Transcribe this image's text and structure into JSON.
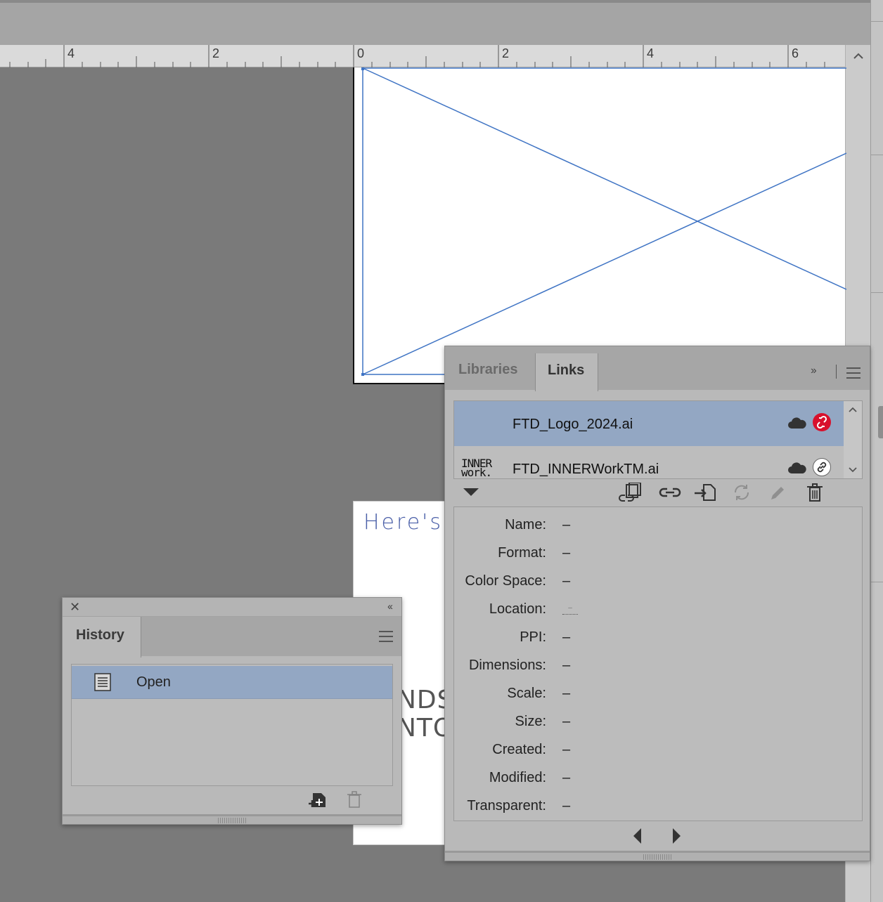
{
  "ruler": {
    "labels": [
      "4",
      "2",
      "0",
      "2",
      "4",
      "6"
    ]
  },
  "page2": {
    "heading": "Here's h",
    "line1": "NDS",
    "line2": "NTO"
  },
  "history": {
    "tab_label": "History",
    "items": [
      {
        "label": "Open",
        "icon": "document-icon",
        "selected": true
      }
    ]
  },
  "links": {
    "tabs": [
      {
        "label": "Libraries",
        "active": false
      },
      {
        "label": "Links",
        "active": true
      }
    ],
    "files": [
      {
        "name": "FTD_Logo_2024.ai",
        "status": "missing",
        "cloud": true,
        "selected": true,
        "thumbnail": ""
      },
      {
        "name": "FTD_INNERWorkTM.ai",
        "status": "linked",
        "cloud": true,
        "selected": false,
        "thumbnail": "INNER work."
      }
    ],
    "info": [
      {
        "label": "Name:",
        "value": "–"
      },
      {
        "label": "Format:",
        "value": "–"
      },
      {
        "label": "Color Space:",
        "value": "–"
      },
      {
        "label": "Location:",
        "value": "–"
      },
      {
        "label": "PPI:",
        "value": "–"
      },
      {
        "label": "Dimensions:",
        "value": "–"
      },
      {
        "label": "Scale:",
        "value": "–"
      },
      {
        "label": "Size:",
        "value": "–"
      },
      {
        "label": "Created:",
        "value": "–"
      },
      {
        "label": "Modified:",
        "value": "–"
      },
      {
        "label": "Transparent:",
        "value": "–"
      }
    ]
  },
  "colors": {
    "selection": "#93a7c3",
    "frame_line": "#3f74c4",
    "missing_link": "#d8102c",
    "page_heading": "#4a5fa8"
  }
}
